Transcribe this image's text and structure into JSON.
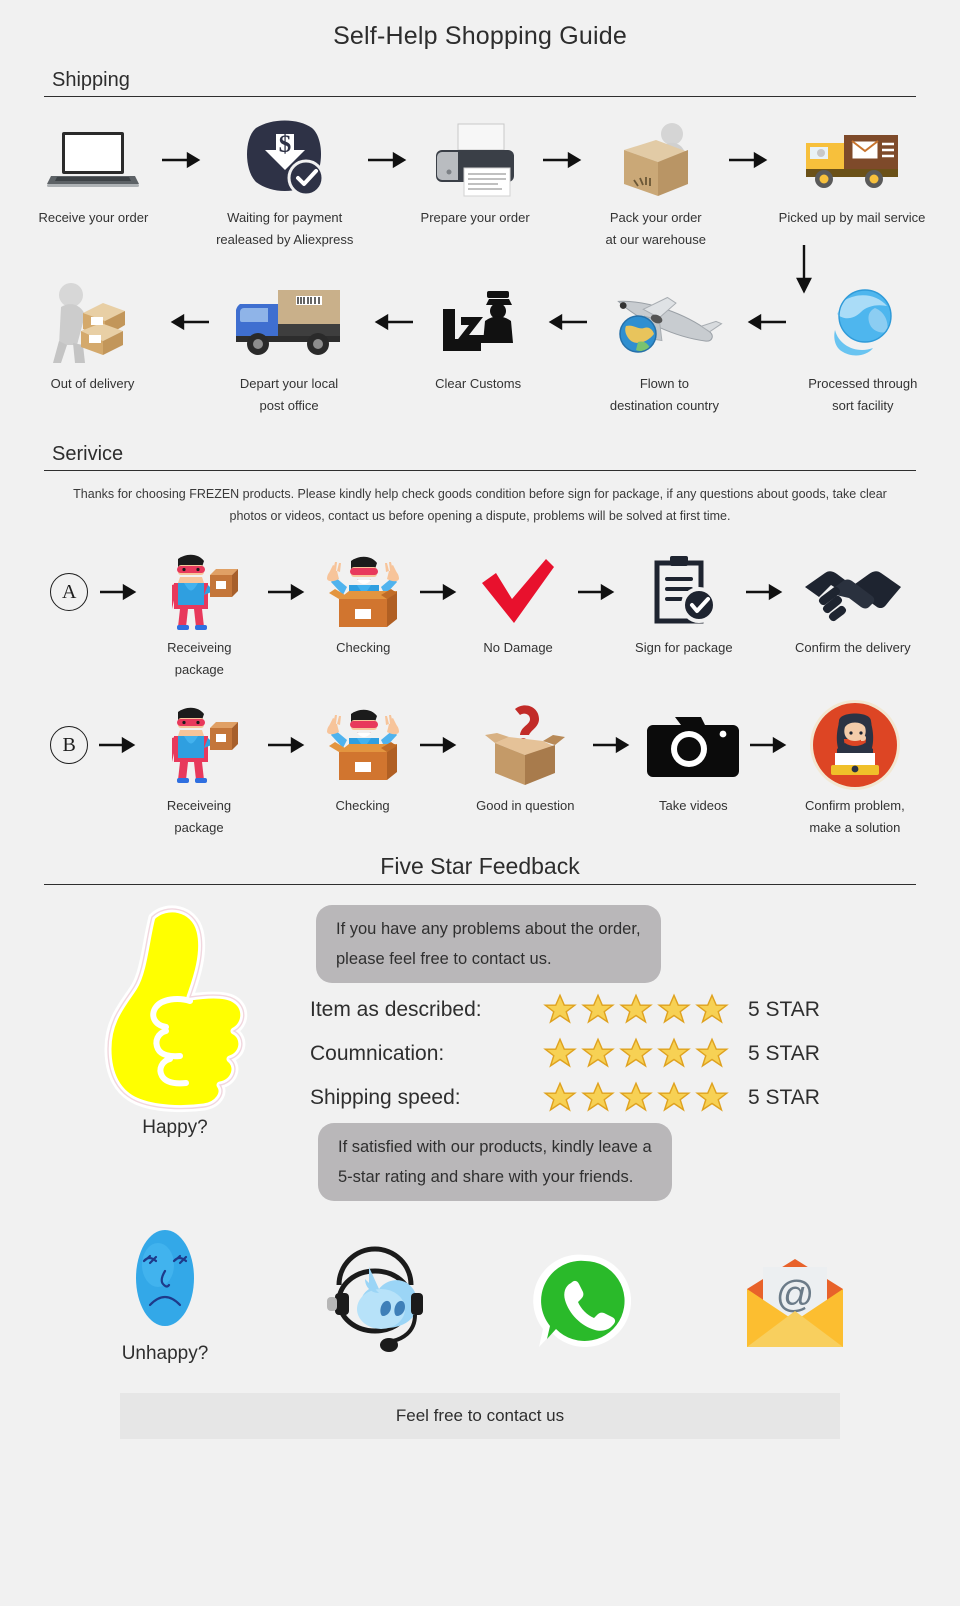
{
  "title": "Self-Help Shopping Guide",
  "sections": {
    "shipping": {
      "heading": "Shipping"
    },
    "service": {
      "heading": "Serivice",
      "paragraph": "Thanks for choosing FREZEN products. Please kindly help check goods condition before sign for package, if any questions about goods, take clear photos or videos, contact us before opening a dispute, problems will be solved at first time."
    },
    "feedback": {
      "heading": "Five Star Feedback"
    }
  },
  "shipping_row1": [
    {
      "icon": "laptop-icon",
      "caption": "Receive your order"
    },
    {
      "icon": "payment-dollar-check-icon",
      "caption": "Waiting for payment\nrealeased by Aliexpress"
    },
    {
      "icon": "printer-icon",
      "caption": "Prepare your order"
    },
    {
      "icon": "packing-worker-icon",
      "caption": "Pack your order\nat our warehouse"
    },
    {
      "icon": "mail-truck-icon",
      "caption": "Picked up by mail service"
    }
  ],
  "shipping_row2": [
    {
      "icon": "delivery-worker-icon",
      "caption": "Out of delivery"
    },
    {
      "icon": "blue-truck-icon",
      "caption": "Depart your local\npost office"
    },
    {
      "icon": "customs-officer-icon",
      "caption": "Clear Customs"
    },
    {
      "icon": "airplane-globe-icon",
      "caption": "Flown to\ndestination country"
    },
    {
      "icon": "globe-sort-icon",
      "caption": "Processed through\nsort facility"
    }
  ],
  "service_row_a": {
    "letter": "A",
    "steps": [
      {
        "icon": "superhero-package-icon",
        "caption": "Receiveing package"
      },
      {
        "icon": "superhero-in-box-icon",
        "caption": "Checking"
      },
      {
        "icon": "red-check-icon",
        "caption": "No Damage"
      },
      {
        "icon": "clipboard-check-icon",
        "caption": "Sign for package"
      },
      {
        "icon": "handshake-icon",
        "caption": "Confirm the delivery"
      }
    ]
  },
  "service_row_b": {
    "letter": "B",
    "steps": [
      {
        "icon": "superhero-package-icon",
        "caption": "Receiveing package"
      },
      {
        "icon": "superhero-in-box-icon",
        "caption": "Checking"
      },
      {
        "icon": "question-box-icon",
        "caption": "Good in question"
      },
      {
        "icon": "camera-icon",
        "caption": "Take videos"
      },
      {
        "icon": "support-agent-icon",
        "caption": "Confirm problem,\nmake a solution"
      }
    ]
  },
  "feedback": {
    "thumb_icon": "thumbs-up-icon",
    "thumb_caption": "Happy?",
    "bubble_top": "If you have any problems about the order,\nplease feel free to contact us.",
    "bubble_bottom": "If  satisfied with our products, kindly leave a\n5-star rating and share with your friends.",
    "ratings": [
      {
        "label": "Item as described:",
        "stars": 5,
        "value": "5 STAR"
      },
      {
        "label": "Coumnication:",
        "stars": 5,
        "value": "5 STAR"
      },
      {
        "label": "Shipping speed:",
        "stars": 5,
        "value": "5 STAR"
      }
    ]
  },
  "contact": {
    "items": [
      {
        "icon": "sad-face-icon",
        "caption": "Unhappy?"
      },
      {
        "icon": "chat-headset-icon",
        "caption": ""
      },
      {
        "icon": "whatsapp-icon",
        "caption": ""
      },
      {
        "icon": "email-at-icon",
        "caption": ""
      }
    ],
    "footer": "Feel free to contact us"
  },
  "colors": {
    "background": "#f1f1f1",
    "bubble": "#b9b7b9",
    "thumb_yellow": "#ffff00",
    "star_gold": "#f5c33b",
    "whatsapp_green": "#2aba2a",
    "agent_red": "#dd4524",
    "footer_bar": "#e6e6e6"
  }
}
